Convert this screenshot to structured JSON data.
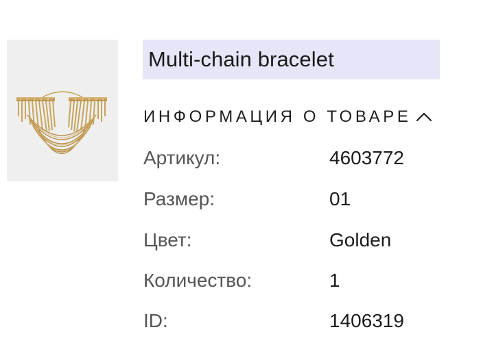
{
  "product": {
    "image_alt": "Multi-chain bracelet image",
    "title": "Multi-chain bracelet"
  },
  "info": {
    "heading": "ИНФОРМАЦИЯ О ТОВАРЕ",
    "chevron_icon": "chevron-up-icon",
    "rows": [
      {
        "label": "Артикул:",
        "value": "4603772"
      },
      {
        "label": "Размер:",
        "value": "01"
      },
      {
        "label": "Цвет:",
        "value": "Golden"
      },
      {
        "label": "Количество:",
        "value": "1"
      },
      {
        "label": "ID:",
        "value": "1406319"
      }
    ]
  },
  "colors": {
    "title_bg": "#e6e6f8",
    "thumb_bg": "#efefef",
    "gold": "#c9a45c"
  }
}
